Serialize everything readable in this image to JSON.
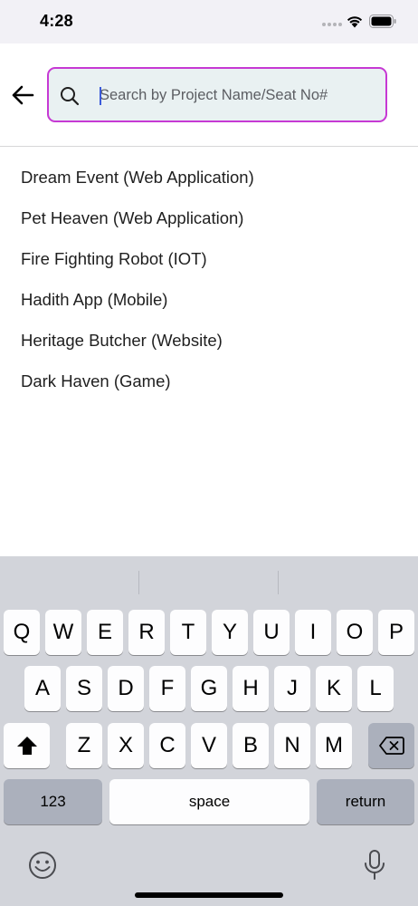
{
  "status_bar": {
    "time": "4:28"
  },
  "search": {
    "placeholder": "Search by Project Name/Seat No#",
    "value": "",
    "accent_color": "#c639d4"
  },
  "projects": [
    "Dream Event (Web Application)",
    "Pet Heaven (Web Application)",
    "Fire Fighting Robot (IOT)",
    "Hadith App (Mobile)",
    "Heritage Butcher (Website)",
    "Dark Haven (Game)"
  ],
  "keyboard": {
    "row1": [
      "Q",
      "W",
      "E",
      "R",
      "T",
      "Y",
      "U",
      "I",
      "O",
      "P"
    ],
    "row2": [
      "A",
      "S",
      "D",
      "F",
      "G",
      "H",
      "J",
      "K",
      "L"
    ],
    "row3": [
      "Z",
      "X",
      "C",
      "V",
      "B",
      "N",
      "M"
    ],
    "numbers_label": "123",
    "space_label": "space",
    "return_label": "return"
  },
  "icons": {
    "back": "arrow-left-icon",
    "search": "magnifier-icon",
    "shift": "shift-icon",
    "delete": "backspace-icon",
    "emoji": "emoji-icon",
    "mic": "microphone-icon",
    "wifi": "wifi-icon",
    "battery": "battery-icon",
    "signal": "signal-icon"
  }
}
